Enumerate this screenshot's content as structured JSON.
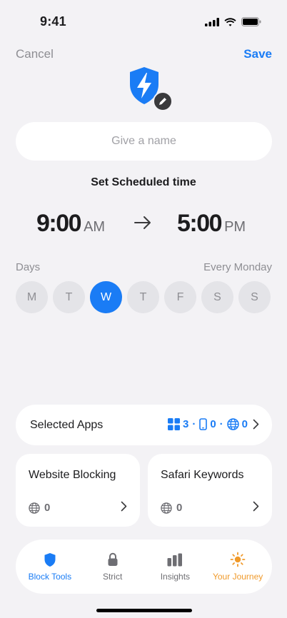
{
  "status": {
    "time": "9:41"
  },
  "nav": {
    "cancel_label": "Cancel",
    "save_label": "Save"
  },
  "name_field": {
    "placeholder": "Give a name",
    "value": ""
  },
  "schedule": {
    "title": "Set Scheduled time",
    "start": {
      "time": "9:00",
      "period": "AM"
    },
    "end": {
      "time": "5:00",
      "period": "PM"
    }
  },
  "days": {
    "label": "Days",
    "summary": "Every Monday",
    "items": [
      {
        "label": "M",
        "active": false
      },
      {
        "label": "T",
        "active": false
      },
      {
        "label": "W",
        "active": true
      },
      {
        "label": "T",
        "active": false
      },
      {
        "label": "F",
        "active": false
      },
      {
        "label": "S",
        "active": false
      },
      {
        "label": "S",
        "active": false
      }
    ]
  },
  "selected_apps": {
    "title": "Selected Apps",
    "apps_count": "3",
    "devices_count": "0",
    "web_count": "0",
    "separator": "·"
  },
  "website_blocking": {
    "title": "Website Blocking",
    "count": "0"
  },
  "safari_keywords": {
    "title": "Safari Keywords",
    "count": "0"
  },
  "tabs": [
    {
      "label": "Block Tools",
      "icon": "shield-icon",
      "active": true
    },
    {
      "label": "Strict",
      "icon": "lock-icon",
      "active": false
    },
    {
      "label": "Insights",
      "icon": "bar-chart-icon",
      "active": false
    },
    {
      "label": "Your Journey",
      "icon": "sun-icon",
      "active": false
    }
  ],
  "colors": {
    "accent": "#1a7cf5",
    "journey": "#f09a2b",
    "background": "#f3f2f5"
  }
}
